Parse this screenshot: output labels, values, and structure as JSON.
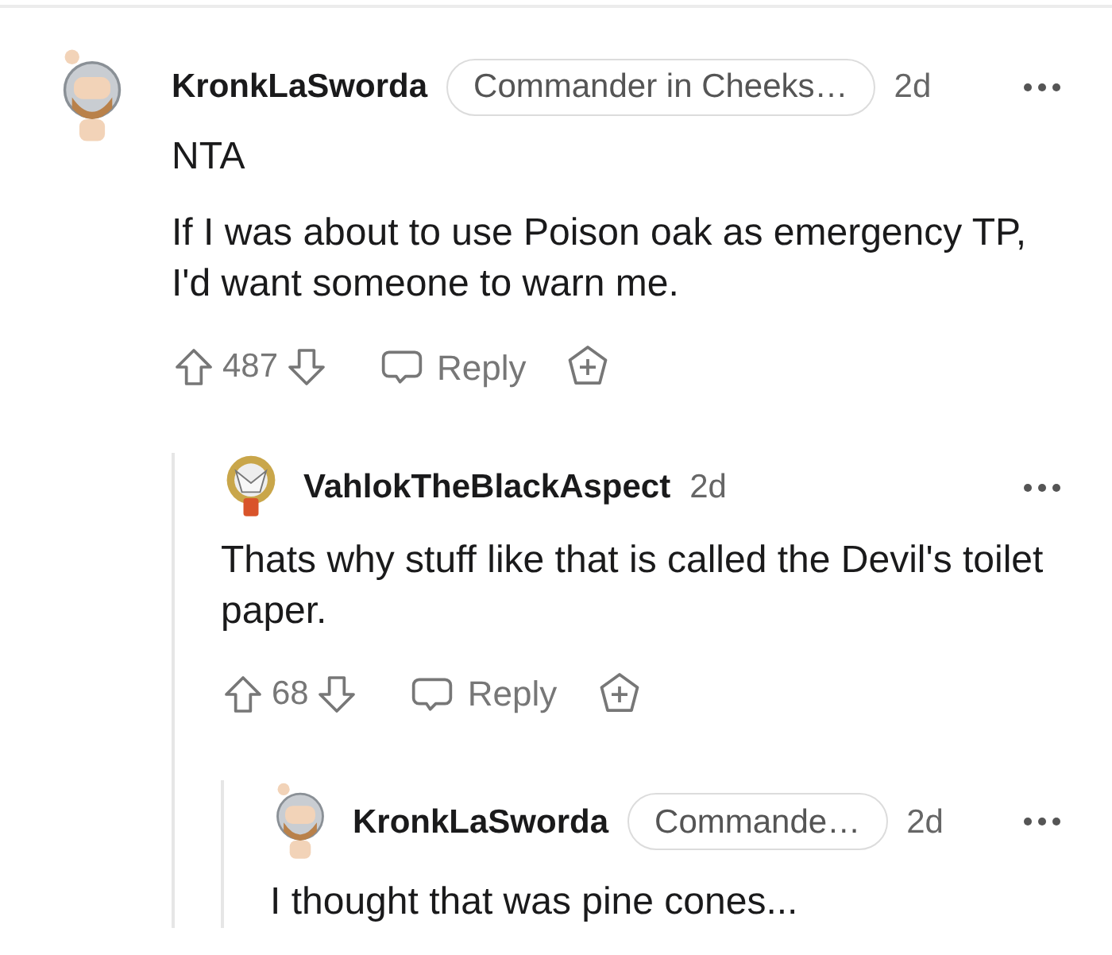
{
  "comments": [
    {
      "author": "KronkLaSworda",
      "flair": "Commander in Cheeks…",
      "time": "2d",
      "avatar": {
        "kind": "helmet"
      },
      "body": [
        "NTA",
        "If I was about to use Poison oak as emergency TP, I'd want someone to warn me."
      ],
      "score": "487",
      "reply_label": "Reply",
      "children": [
        {
          "author": "VahlokTheBlackAspect",
          "time": "2d",
          "avatar": {
            "kind": "beast"
          },
          "body": [
            "Thats why stuff like that is called the Devil's toilet paper."
          ],
          "score": "68",
          "reply_label": "Reply",
          "children": [
            {
              "author": "KronkLaSworda",
              "flair": "Commande…",
              "time": "2d",
              "avatar": {
                "kind": "helmet"
              },
              "body": [
                "I thought that was pine cones..."
              ]
            }
          ]
        }
      ]
    }
  ]
}
